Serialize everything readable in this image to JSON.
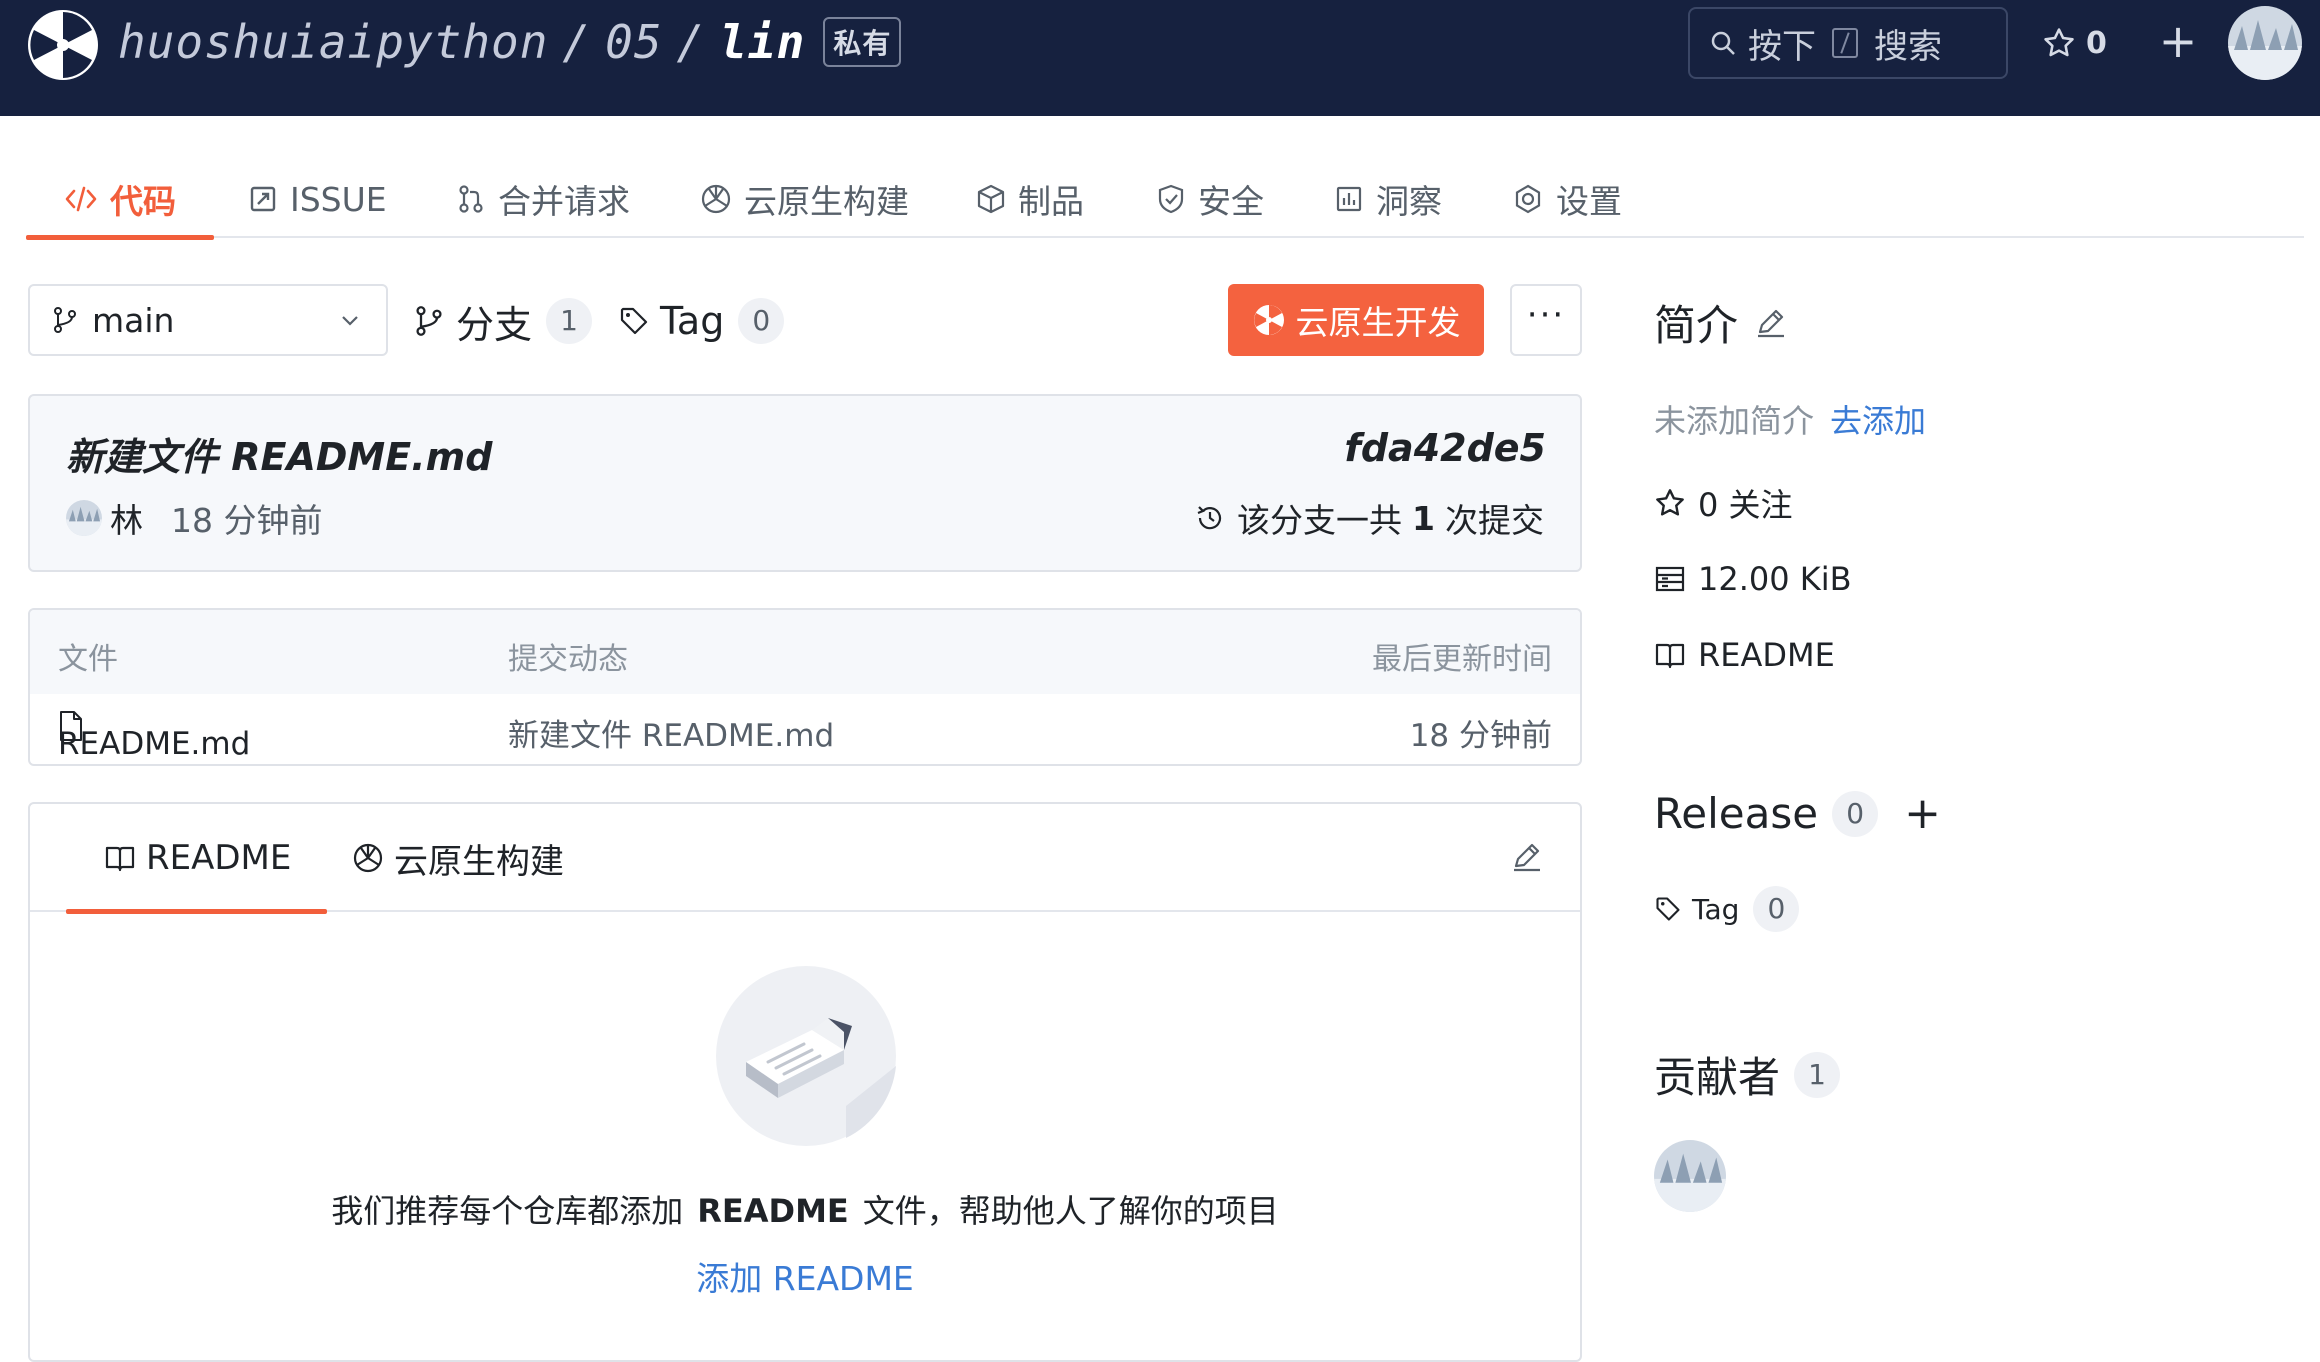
{
  "header": {
    "owner": "huoshuiaipython",
    "group": "05",
    "repo": "lin",
    "visibility": "私有",
    "search_prefix": "按下",
    "search_label": "搜索",
    "star_count": "0",
    "add_label": "+"
  },
  "tabs": [
    {
      "label": "代码",
      "icon": "code-icon",
      "active": true
    },
    {
      "label": "ISSUE",
      "icon": "issue-icon"
    },
    {
      "label": "合并请求",
      "icon": "merge-request-icon"
    },
    {
      "label": "云原生构建",
      "icon": "cloud-build-icon"
    },
    {
      "label": "制品",
      "icon": "package-icon"
    },
    {
      "label": "安全",
      "icon": "shield-icon"
    },
    {
      "label": "洞察",
      "icon": "insights-icon"
    },
    {
      "label": "设置",
      "icon": "settings-icon"
    }
  ],
  "branch_bar": {
    "current_branch": "main",
    "branches_label": "分支",
    "branches_count": "1",
    "tags_label": "Tag",
    "tags_count": "0",
    "cloud_dev_label": "云原生开发",
    "more_label": "···"
  },
  "last_commit": {
    "message": "新建文件 README.md",
    "hash": "fda42de5",
    "author": "林",
    "time": "18 分钟前",
    "count_prefix": "该分支一共",
    "count": "1",
    "count_suffix": "次提交"
  },
  "file_table": {
    "headers": [
      "文件",
      "提交动态",
      "最后更新时间"
    ],
    "rows": [
      {
        "name": "README.md",
        "commit": "新建文件 README.md",
        "updated": "18 分钟前"
      }
    ]
  },
  "readme": {
    "tabs": [
      "README",
      "云原生构建"
    ],
    "empty_prefix": "我们推荐每个仓库都添加",
    "empty_bold": "README",
    "empty_suffix": "文件，帮助他人了解你的项目",
    "add_link": "添加 README"
  },
  "sidebar": {
    "intro_title": "简介",
    "intro_empty": "未添加简介",
    "intro_add": "去添加",
    "stars": "0 关注",
    "size": "12.00 KiB",
    "readme_link": "README",
    "release_title": "Release",
    "release_count": "0",
    "release_add": "+",
    "tag_label": "Tag",
    "tag_count": "0",
    "contributors_title": "贡献者",
    "contributors_count": "1"
  },
  "colors": {
    "header_bg": "#16213f",
    "accent": "#f25e3b",
    "link": "#3a7bd5"
  }
}
